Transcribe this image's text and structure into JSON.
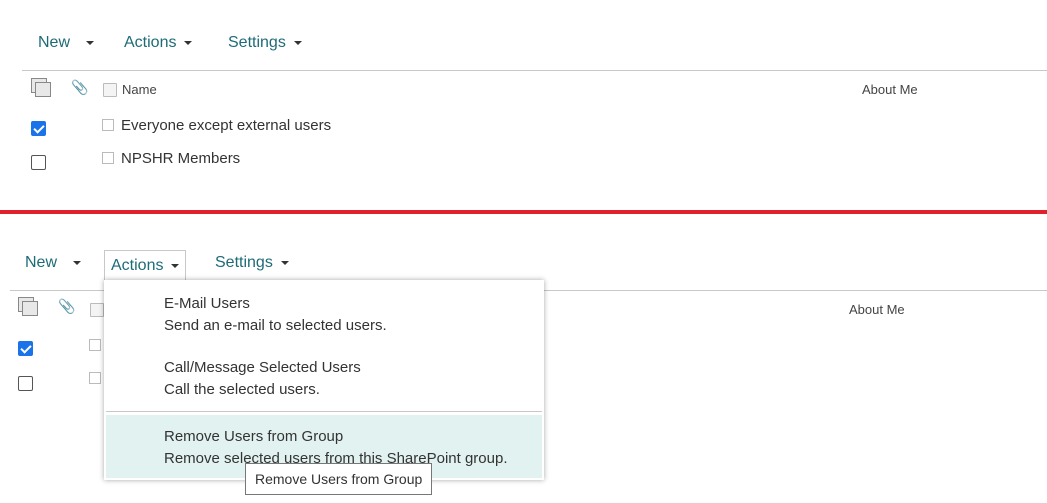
{
  "toolbar": {
    "new_label": "New",
    "actions_label": "Actions",
    "settings_label": "Settings"
  },
  "list": {
    "columns": {
      "name": "Name",
      "about": "About Me"
    },
    "rows": [
      {
        "name": "Everyone except external users",
        "checked": true
      },
      {
        "name": "NPSHR Members",
        "checked": false
      }
    ]
  },
  "actions_menu": {
    "items": [
      {
        "title": "E-Mail Users",
        "description": "Send an e-mail to selected users."
      },
      {
        "title": "Call/Message Selected Users",
        "description": "Call the selected users."
      },
      {
        "title": "Remove Users from Group",
        "description": "Remove selected users from this SharePoint group."
      }
    ]
  },
  "tooltip": "Remove Users from Group",
  "colors": {
    "accent": "#1e6b78",
    "divider": "#e0202b",
    "highlight": "#e1f2f1",
    "checkbox": "#1a73e8"
  },
  "icons": [
    "documents-icon",
    "paperclip-icon",
    "caret-down-icon",
    "checkmark-icon"
  ]
}
